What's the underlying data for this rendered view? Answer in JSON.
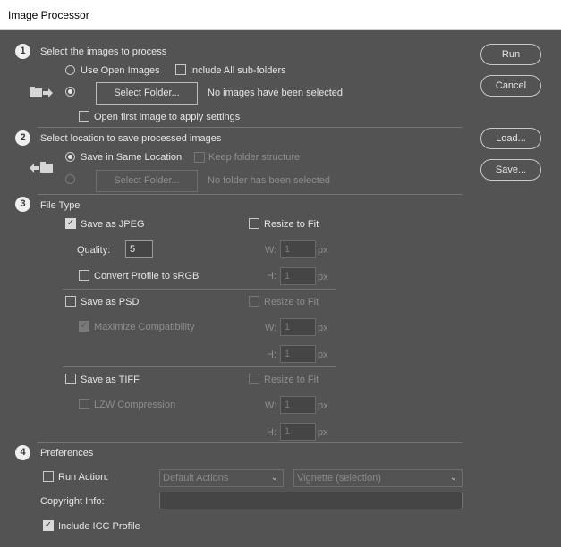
{
  "window": {
    "title": "Image Processor"
  },
  "step1": {
    "number": "1",
    "heading": "Select the images to process",
    "use_open_images": "Use Open Images",
    "include_subfolders": "Include All sub-folders",
    "select_folder_btn": "Select Folder...",
    "status": "No images have been selected",
    "open_first_image": "Open first image to apply settings"
  },
  "step2": {
    "number": "2",
    "heading": "Select location to save processed images",
    "save_same_location": "Save in Same Location",
    "keep_folder_structure": "Keep folder structure",
    "select_folder_btn": "Select Folder...",
    "status": "No folder has been selected"
  },
  "step3": {
    "number": "3",
    "heading": "File Type",
    "jpeg": {
      "save_label": "Save as JPEG",
      "resize_label": "Resize to Fit",
      "quality_label": "Quality:",
      "quality_value": "5",
      "w_label": "W:",
      "w_value": "1",
      "w_unit": "px",
      "h_label": "H:",
      "h_value": "1",
      "h_unit": "px",
      "convert_profile": "Convert Profile to sRGB"
    },
    "psd": {
      "save_label": "Save as PSD",
      "resize_label": "Resize to Fit",
      "maximize": "Maximize Compatibility",
      "w_label": "W:",
      "w_value": "1",
      "w_unit": "px",
      "h_label": "H:",
      "h_value": "1",
      "h_unit": "px"
    },
    "tiff": {
      "save_label": "Save as TIFF",
      "resize_label": "Resize to Fit",
      "lzw": "LZW Compression",
      "w_label": "W:",
      "w_value": "1",
      "w_unit": "px",
      "h_label": "H:",
      "h_value": "1",
      "h_unit": "px"
    }
  },
  "step4": {
    "number": "4",
    "heading": "Preferences",
    "run_action": "Run Action:",
    "action_set": "Default Actions",
    "action": "Vignette (selection)",
    "copyright_label": "Copyright Info:",
    "copyright_value": "",
    "include_icc": "Include ICC Profile"
  },
  "buttons": {
    "run": "Run",
    "cancel": "Cancel",
    "load": "Load...",
    "save": "Save..."
  },
  "colors": {
    "background": "#535353",
    "text": "#e6e6e6",
    "disabled_text": "#8e8e8e"
  }
}
